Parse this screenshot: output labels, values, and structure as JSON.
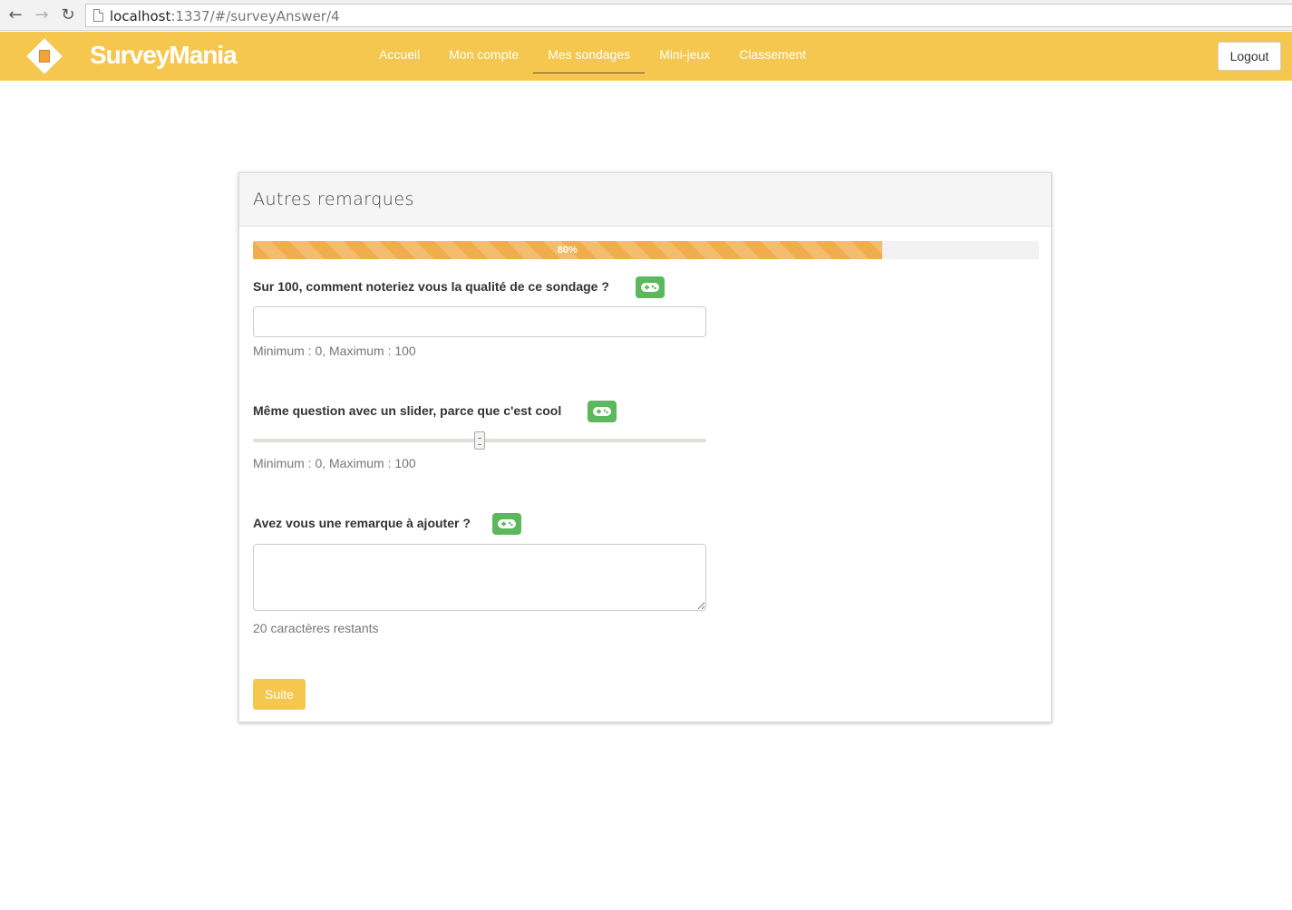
{
  "browser": {
    "url_host": "localhost",
    "url_rest": ":1337/#/surveyAnswer/4"
  },
  "navbar": {
    "brand": "SurveyMania",
    "menu": [
      {
        "label": "Accueil"
      },
      {
        "label": "Mon compte"
      },
      {
        "label": "Mes sondages",
        "active": true
      },
      {
        "label": "Mini-jeux"
      },
      {
        "label": "Classement"
      }
    ],
    "logout": "Logout"
  },
  "panel": {
    "title": "Autres remarques",
    "progress_label": "80%",
    "progress_value": 0.8
  },
  "questions": [
    {
      "label": "Sur 100, comment noteriez vous la qualité de ce sondage ?",
      "hint": "Minimum : 0, Maximum : 100",
      "value": ""
    },
    {
      "label": "Même question avec un slider, parce que c'est cool",
      "hint": "Minimum : 0, Maximum : 100",
      "slider_value": 50
    },
    {
      "label": "Avez vous une remarque à ajouter ?",
      "hint": "20 caractères restants",
      "value": ""
    }
  ],
  "actions": {
    "next": "Suite"
  },
  "colors": {
    "accent": "#f5c74f",
    "progress": "#f0ad4e",
    "game_badge": "#5cb85c"
  },
  "icons": [
    "back-icon",
    "forward-icon",
    "reload-icon",
    "page-icon",
    "survey-logo-icon",
    "gamepad-icon"
  ]
}
